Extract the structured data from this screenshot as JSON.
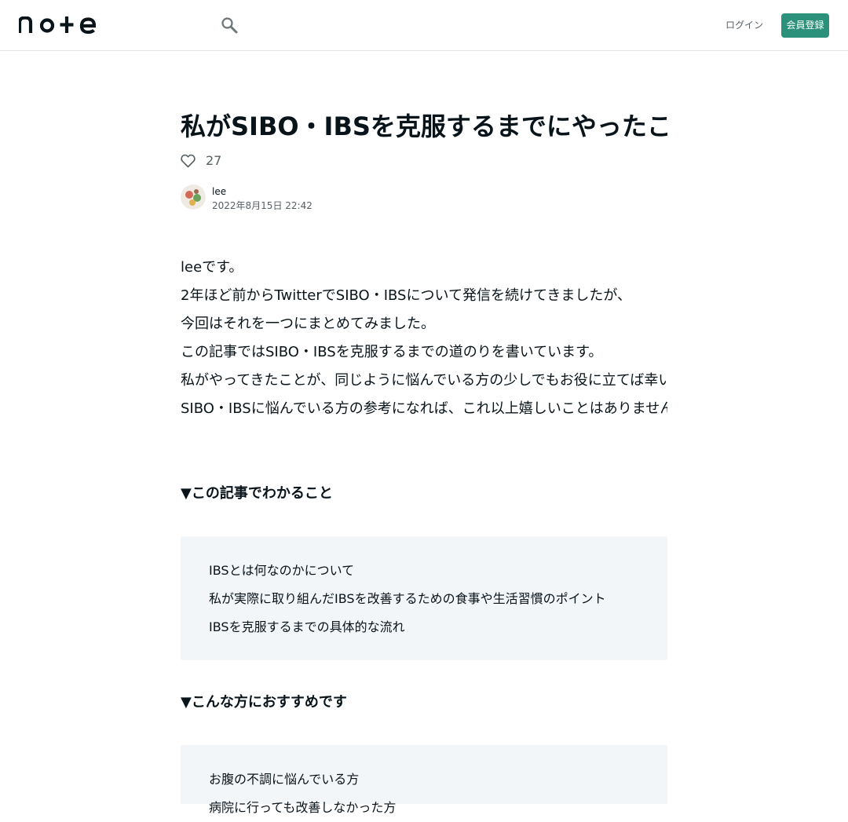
{
  "header": {
    "logo_text": "note",
    "login_label": "ログイン",
    "signup_label": "会員登録"
  },
  "article": {
    "title": "私がSIBO・IBSを克服するまでにやったこと",
    "like_count": "27",
    "author": "lee",
    "date": "2022年8月15日 22:42",
    "body_lines": [
      "leeです。",
      "2年ほど前からTwitterでSIBO・IBSについて発信を続けてきましたが、",
      "今回はそれを一つにまとめてみました。",
      "この記事ではSIBO・IBSを克服するまでの道のりを書いています。",
      "私がやってきたことが、同じように悩んでいる方の少しでもお役に立てば幸いです。",
      "SIBO・IBSに悩んでいる方の参考になれば、これ以上嬉しいことはありません。"
    ],
    "section1_heading": "▼この記事でわかること",
    "section1_lines": [
      "IBSとは何なのかについて",
      "私が実際に取り組んだIBSを改善するための食事や生活習慣のポイント",
      "IBSを克服するまでの具体的な流れ"
    ],
    "section2_heading": "▼こんな方におすすめです",
    "section2_lines": [
      "お腹の不調に悩んでいる方",
      "病院に行っても改善しなかった方"
    ]
  },
  "colors": {
    "accent": "#2b917b",
    "text": "#08131a",
    "muted": "#555f64",
    "quote_bg": "#f3f6f9"
  },
  "icons": {
    "search": "search-icon",
    "like": "heart-icon"
  }
}
